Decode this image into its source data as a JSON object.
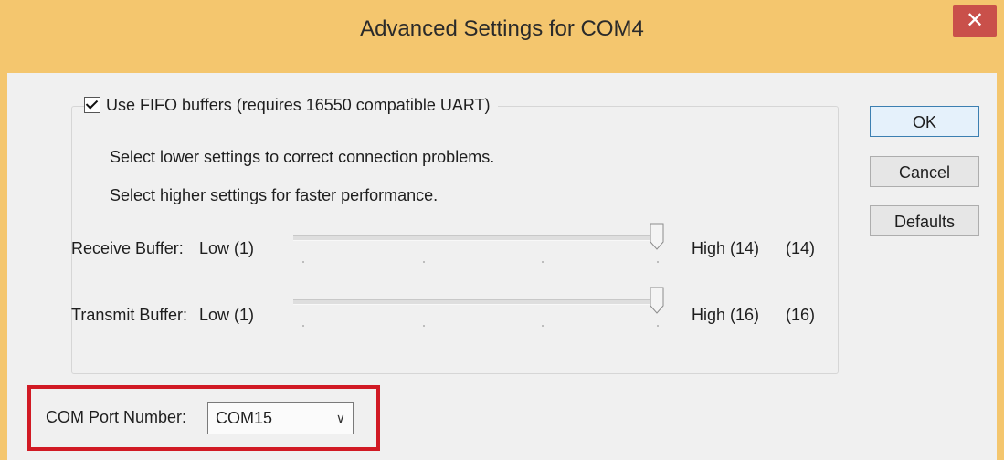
{
  "window": {
    "title": "Advanced Settings for COM4",
    "close_glyph": "✕"
  },
  "fifo": {
    "checkbox_label": "Use FIFO buffers (requires 16550 compatible UART)",
    "checked": true,
    "hint_lower": "Select lower settings to correct connection problems.",
    "hint_higher": "Select higher settings for faster performance."
  },
  "receive_buffer": {
    "label": "Receive Buffer:",
    "low_label": "Low (1)",
    "high_label": "High (14)",
    "current": "(14)",
    "min": 1,
    "max": 14,
    "value": 14
  },
  "transmit_buffer": {
    "label": "Transmit Buffer:",
    "low_label": "Low (1)",
    "high_label": "High (16)",
    "current": "(16)",
    "min": 1,
    "max": 16,
    "value": 16
  },
  "buttons": {
    "ok": "OK",
    "cancel": "Cancel",
    "defaults": "Defaults"
  },
  "com_port": {
    "label": "COM Port Number:",
    "selected": "COM15",
    "highlight_color": "#d11a24"
  },
  "colors": {
    "titlebar": "#f4c66e",
    "close_button": "#c9504a",
    "dialog_bg": "#f0f0f0"
  }
}
